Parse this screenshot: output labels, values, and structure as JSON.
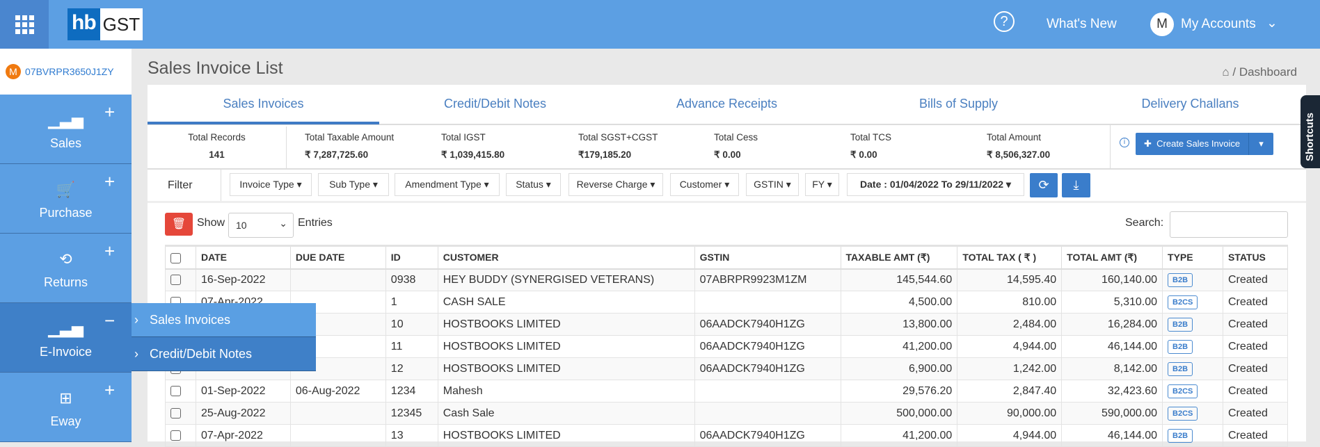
{
  "header": {
    "logo_left": "hb",
    "logo_right": "GST",
    "help_icon": "question-circle-icon",
    "whats_new": "What's New",
    "avatar_initial": "M",
    "my_accounts": "My Accounts"
  },
  "account": {
    "initial": "M",
    "gstin": "07BVRPR3650J1ZY"
  },
  "sidebar": {
    "items": [
      {
        "label": "Sales",
        "icon": "bar-chart-icon",
        "toggle": "+"
      },
      {
        "label": "Purchase",
        "icon": "cart-icon",
        "toggle": "+"
      },
      {
        "label": "Returns",
        "icon": "refresh-icon",
        "toggle": "+"
      },
      {
        "label": "E-Invoice",
        "icon": "bar-chart-icon",
        "toggle": "−",
        "active": true
      },
      {
        "label": "Eway",
        "icon": "grid-icon",
        "toggle": "+"
      }
    ]
  },
  "submenu": {
    "items": [
      {
        "label": "Sales Invoices"
      },
      {
        "label": "Credit/Debit Notes"
      }
    ]
  },
  "page": {
    "title": "Sales Invoice List",
    "breadcrumb": "Dashboard"
  },
  "tabs": [
    {
      "label": "Sales Invoices",
      "active": true
    },
    {
      "label": "Credit/Debit Notes"
    },
    {
      "label": "Advance Receipts"
    },
    {
      "label": "Bills of Supply"
    },
    {
      "label": "Delivery Challans"
    }
  ],
  "totals": [
    {
      "label": "Total Records",
      "value": "141"
    },
    {
      "label": "Total Taxable Amount",
      "value": "₹ 7,287,725.60"
    },
    {
      "label": "Total IGST",
      "value": "₹ 1,039,415.80"
    },
    {
      "label": "Total SGST+CGST",
      "value": "₹179,185.20"
    },
    {
      "label": "Total Cess",
      "value": "₹ 0.00"
    },
    {
      "label": "Total TCS",
      "value": "₹ 0.00"
    },
    {
      "label": "Total Amount",
      "value": "₹ 8,506,327.00"
    }
  ],
  "create_button": "Create Sales Invoice",
  "filter": {
    "label": "Filter",
    "buttons": [
      "Invoice Type",
      "Sub Type",
      "Amendment Type",
      "Status",
      "Reverse Charge",
      "Customer",
      "GSTIN",
      "FY"
    ],
    "date": "Date : 01/04/2022 To 29/11/2022"
  },
  "list": {
    "show": "Show",
    "entries_value": "10",
    "entries": "Entries",
    "search": "Search:",
    "search_value": ""
  },
  "table": {
    "columns": [
      "DATE",
      "DUE DATE",
      "ID",
      "CUSTOMER",
      "GSTIN",
      "TAXABLE AMT (₹)",
      "TOTAL TAX ( ₹ )",
      "TOTAL AMT (₹)",
      "TYPE",
      "STATUS"
    ],
    "rows": [
      [
        "16-Sep-2022",
        "",
        "0938",
        "HEY BUDDY (SYNERGISED VETERANS)",
        "07ABRPR9923M1ZM",
        "145,544.60",
        "14,595.40",
        "160,140.00",
        "B2B",
        "Created"
      ],
      [
        "07-Apr-2022",
        "",
        "1",
        "CASH SALE",
        "",
        "4,500.00",
        "810.00",
        "5,310.00",
        "B2CS",
        "Created"
      ],
      [
        "",
        "",
        "10",
        "HOSTBOOKS LIMITED",
        "06AADCK7940H1ZG",
        "13,800.00",
        "2,484.00",
        "16,284.00",
        "B2B",
        "Created"
      ],
      [
        "",
        "",
        "11",
        "HOSTBOOKS LIMITED",
        "06AADCK7940H1ZG",
        "41,200.00",
        "4,944.00",
        "46,144.00",
        "B2B",
        "Created"
      ],
      [
        "",
        "",
        "12",
        "HOSTBOOKS LIMITED",
        "06AADCK7940H1ZG",
        "6,900.00",
        "1,242.00",
        "8,142.00",
        "B2B",
        "Created"
      ],
      [
        "01-Sep-2022",
        "06-Aug-2022",
        "1234",
        "Mahesh",
        "",
        "29,576.20",
        "2,847.40",
        "32,423.60",
        "B2CS",
        "Created"
      ],
      [
        "25-Aug-2022",
        "",
        "12345",
        "Cash Sale",
        "",
        "500,000.00",
        "90,000.00",
        "590,000.00",
        "B2CS",
        "Created"
      ],
      [
        "07-Apr-2022",
        "",
        "13",
        "HOSTBOOKS LIMITED",
        "06AADCK7940H1ZG",
        "41,200.00",
        "4,944.00",
        "46,144.00",
        "B2B",
        "Created"
      ]
    ]
  },
  "shortcuts": "Shortcuts",
  "colors": {
    "topbar": "#5c9fe3",
    "accent": "#3a7dcb",
    "delete": "#e5473a",
    "active_menu": "#3f80c8"
  }
}
